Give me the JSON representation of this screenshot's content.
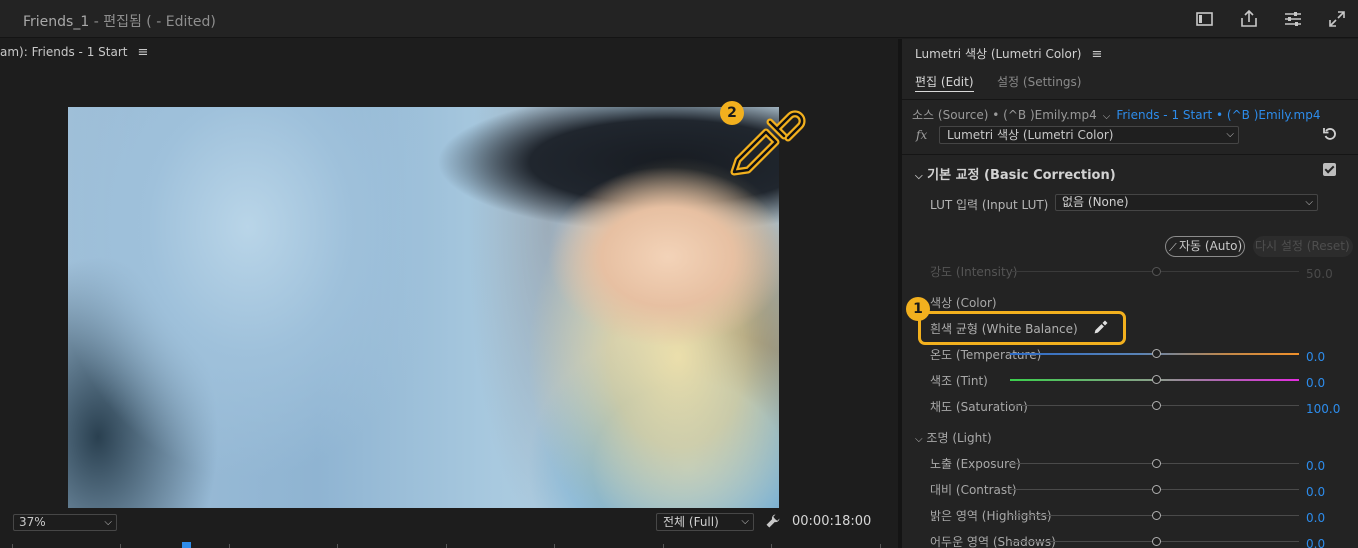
{
  "titlebar": {
    "project_name": "Friends_1",
    "edit_state": " - 편집됨 ( - Edited)"
  },
  "monitor": {
    "header": "am): Friends - 1 Start",
    "menu_icon": "≡",
    "zoom": "37%",
    "fit": "전체 (Full)",
    "timecode": "00:00:18:00"
  },
  "panel": {
    "title": "Lumetri 색상 (Lumetri Color)",
    "menu_icon": "≡",
    "tabs": {
      "edit": "편집 (Edit)",
      "settings": "설정 (Settings)"
    },
    "source_text": "소스 (Source) • (^B )Emily.mp4",
    "sequence_text": "Friends - 1 Start • (^B )Emily.mp4",
    "fx_label": "fx",
    "effect_select": "Lumetri 색상 (Lumetri Color)",
    "basic_correction": "기본 교정 (Basic Correction)",
    "lut_label": "LUT 입력 (Input LUT)",
    "lut_value": "없음 (None)",
    "auto_label": "자동 (Auto)",
    "reset_label": "다시 설정 (Reset)",
    "intensity_label": "강도 (Intensity)",
    "intensity_value": "50.0",
    "color_section": "색상 (Color)",
    "white_balance_label": "흰색 균형 (White Balance)",
    "temperature_label": "온도 (Temperature)",
    "temperature_value": "0.0",
    "tint_label": "색조 (Tint)",
    "tint_value": "0.0",
    "saturation_label": "채도 (Saturation)",
    "saturation_value": "100.0",
    "light_section": "조명 (Light)",
    "exposure_label": "노출 (Exposure)",
    "exposure_value": "0.0",
    "contrast_label": "대비 (Contrast)",
    "contrast_value": "0.0",
    "highlights_label": "밝은 영역 (Highlights)",
    "highlights_value": "0.0",
    "shadows_label": "어두운 영역 (Shadows)",
    "shadows_value": "0.0"
  },
  "annotations": {
    "badge_1": "1",
    "badge_2": "2",
    "highlight_color": "#f2b01e"
  },
  "colors": {
    "accent_blue": "#2d8ceb",
    "panel_bg": "#232323",
    "monitor_bg": "#1d1d1d"
  },
  "icons": [
    "panel-layout-icon",
    "export-icon",
    "settings-sliders-icon",
    "fullscreen-icon",
    "wrench-icon",
    "reset-icon",
    "eyedropper-icon",
    "wand-icon",
    "chevron-down-icon"
  ]
}
